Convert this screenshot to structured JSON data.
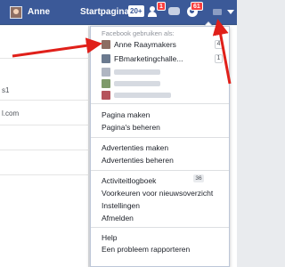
{
  "topbar": {
    "user_name": "Anne",
    "home_label": "Startpagina",
    "home_badge": "20+",
    "friend_requests_badge": "1",
    "notifications_badge": "61"
  },
  "background": {
    "row_texts": [
      "s1",
      "l.com"
    ]
  },
  "menu": {
    "header": "Facebook gebruiken als:",
    "accounts": [
      {
        "name": "Anne Raaymakers",
        "count": "4"
      },
      {
        "name": "FBmarketingchalle...",
        "count": "1"
      }
    ],
    "pages_section": [
      "Pagina maken",
      "Pagina's beheren"
    ],
    "ads_section": [
      "Advertenties maken",
      "Advertenties beheren"
    ],
    "account_section": {
      "activity_log": "Activiteitlogboek",
      "activity_log_count": "36",
      "news_feed_prefs": "Voorkeuren voor nieuwsoverzicht",
      "settings": "Instellingen",
      "logout": "Afmelden"
    },
    "help_section": [
      "Help",
      "Een probleem rapporteren"
    ]
  },
  "colors": {
    "brand": "#3b5998",
    "badge_red": "#fa3e3e",
    "annotation_arrow": "#e0201a"
  },
  "icons": [
    "friend-requests-icon",
    "messages-icon",
    "notifications-icon",
    "privacy-shortcuts-icon",
    "settings-dropdown-arrow-icon"
  ]
}
